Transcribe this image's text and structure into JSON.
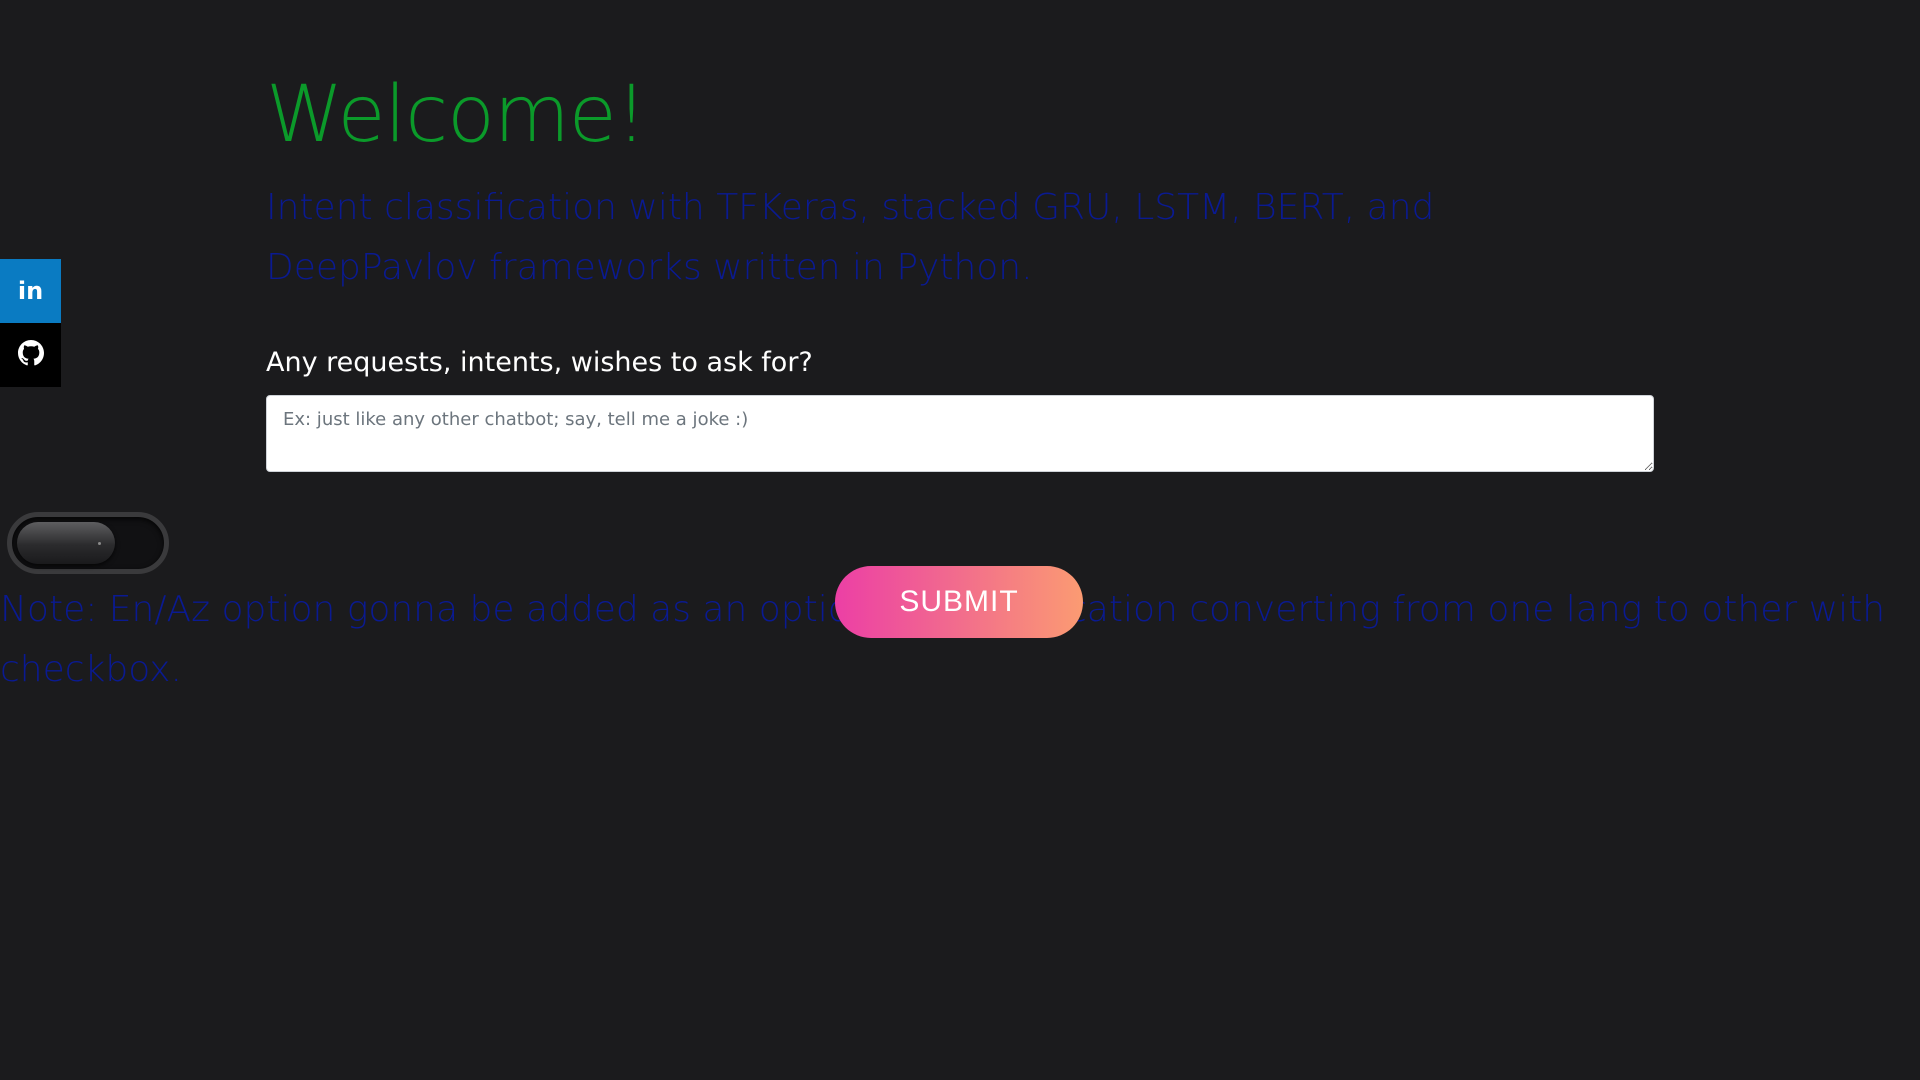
{
  "social": {
    "linkedin_glyph": "in",
    "github_glyph": "❁",
    "linkedin_color": "#0a7bc2",
    "github_color": "#000000"
  },
  "header": {
    "title": "Welcome!",
    "subtitle": "Intent classification with TFKeras, stacked GRU, LSTM, BERT, and DeepPavlov frameworks written in Python."
  },
  "form": {
    "label": "Any requests, intents, wishes to ask for?",
    "placeholder": "Ex: just like any other chatbot; say, tell me a joke :)",
    "value": "",
    "submit_label": "SUBMIT"
  },
  "toggle": {
    "state": "off"
  },
  "note": {
    "text": "Note: En/Az option gonna be added as an option for classification converting from one lang to other with checkbox."
  },
  "colors": {
    "background": "#1b1b1d",
    "title": "#0b9a2a",
    "subtitle": "#0a1a92",
    "submit_gradient_start": "#ec3fa5",
    "submit_gradient_end": "#fb9b72"
  }
}
